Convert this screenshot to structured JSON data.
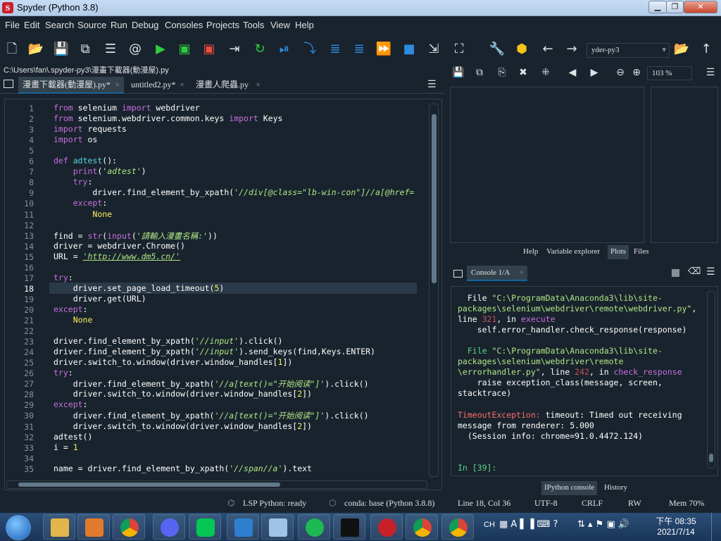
{
  "window": {
    "title": "Spyder (Python 3.8)",
    "icon_letter": "S"
  },
  "menu": [
    "File",
    "Edit",
    "Search",
    "Source",
    "Run",
    "Debug",
    "Consoles",
    "Projects",
    "Tools",
    "View",
    "Help"
  ],
  "toolbar": {
    "env_combo": "yder-py3"
  },
  "path": "C:\\Users\\fan\\.spyder-py3\\漫畫下載器(動漫屋).py",
  "editor_tabs": [
    {
      "label": "漫畫下載器(動漫屋).py*",
      "close": "×"
    },
    {
      "label": "untitled2.py*",
      "close": "×"
    },
    {
      "label": "漫畫人爬蟲.py",
      "close": "×"
    }
  ],
  "code_lines": [
    "<span class='kw'>from</span> selenium <span class='kw'>import</span> webdriver",
    "<span class='kw'>from</span> selenium.webdriver.common.keys <span class='kw'>import</span> Keys",
    "<span class='kw'>import</span> requests",
    "<span class='kw'>import</span> os",
    "",
    "<span class='kw'>def</span> <span class='fn'>adtest</span>():",
    "    <span class='bi'>print</span>(<span class='st'>'adtest'</span>)",
    "    <span class='kw'>try</span>:",
    "        driver.find_element_by_xpath(<span class='st'>'//div[@class=\"lb-win-con\"]//a[@href=</span>",
    "    <span class='kw'>except</span>:",
    "        <span class='nm'>None</span>",
    "",
    "find = <span class='bi'>str</span>(<span class='bi'>input</span>(<span class='st'>'請輸入漫畫名稱:'</span>))",
    "driver = webdriver.Chrome()",
    "URL = <span class='lk'>'http://www.dm5.cn/'</span>",
    "",
    "<span class='kw'>try</span>:",
    "    driver.set_page_load_timeout(<span class='nm'>5</span>)",
    "    driver.get(URL)",
    "<span class='kw'>except</span>:",
    "    <span class='nm'>None</span>",
    "",
    "driver.find_element_by_xpath(<span class='st'>'//input'</span>).click()",
    "driver.find_element_by_xpath(<span class='st'>'//input'</span>).send_keys(find,Keys.ENTER)",
    "driver.switch_to.window(driver.window_handles[<span class='nm'>1</span>])",
    "<span class='kw'>try</span>:",
    "    driver.find_element_by_xpath(<span class='st'>'//a[text()=\"开始阅读\"]'</span>).click()",
    "    driver.switch_to.window(driver.window_handles[<span class='nm'>2</span>])",
    "<span class='kw'>except</span>:",
    "    driver.find_element_by_xpath(<span class='st'>'//a[text()=\"开始阅读\"]'</span>).click()",
    "    driver.switch_to.window(driver.window_handles[<span class='nm'>2</span>])",
    "adtest()",
    "i = <span class='nm'>1</span>",
    "",
    "name = driver.find_element_by_xpath(<span class='st'>'//span//a'</span>).text"
  ],
  "current_line": 18,
  "plots": {
    "zoom": "103 %",
    "tabs": [
      "Help",
      "Variable explorer",
      "Plots",
      "Files"
    ],
    "active_tab": "Plots"
  },
  "console": {
    "tab": "Console 1/A",
    "close": "×",
    "lines": [
      "  File <span class='cs'>\"C:\\ProgramData\\Anaconda3\\lib\\site-</span>",
      "<span class='cs'>packages\\selenium\\webdriver\\remote\\webdriver.py\"</span>,",
      "line <span class='cn'>321</span>, in <span class='cm'>execute</span>",
      "    self.error_handler.check_response(response)",
      "",
      "  <span class='cg'>File</span> <span class='cs'>\"C:\\ProgramData\\Anaconda3\\lib\\site-</span>",
      "<span class='cs'>packages\\selenium\\webdriver\\remote</span>",
      "<span class='cs'>\\errorhandler.py\"</span>, line <span class='cn'>242</span>, in <span class='cm'>check_response</span>",
      "    raise exception_class(message, screen,",
      "stacktrace)",
      "",
      "<span class='cr'>TimeoutException:</span> timeout: Timed out receiving",
      "message from renderer: 5.000",
      "  (Session info: chrome=91.0.4472.124)",
      "",
      "",
      "<span class='cg'>In [39]:</span>"
    ],
    "tabs": [
      "IPython console",
      "History"
    ],
    "active_tab": "IPython console"
  },
  "status": {
    "lsp": "LSP Python: ready",
    "conda": "conda: base (Python 3.8.8)",
    "position": "Line 18, Col 36",
    "encoding": "UTF-8",
    "eol": "CRLF",
    "perm": "RW",
    "mem": "Mem 70%"
  },
  "clock": {
    "time": "下午 08:35",
    "date": "2021/7/14"
  },
  "tray": {
    "lang": "CH"
  }
}
